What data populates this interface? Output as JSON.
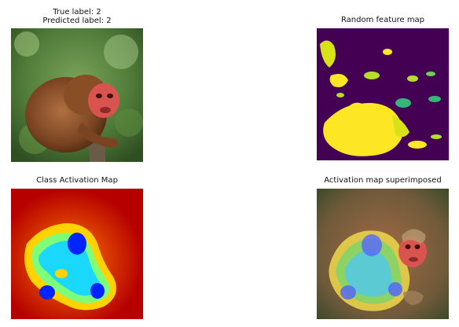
{
  "panels": {
    "top_left": {
      "title_line1": "True label: 2",
      "title_line2": "Predicted label: 2",
      "icon": "monkey-photo"
    },
    "top_right": {
      "title": "Random feature map",
      "icon": "feature-map-heatmap"
    },
    "bottom_left": {
      "title": "Class Activation Map",
      "icon": "class-activation-heatmap"
    },
    "bottom_right": {
      "title": "Activation map superimposed",
      "icon": "superimposed-activation-photo"
    }
  },
  "colors": {
    "background": "#ffffff",
    "viridis_purple": "#440154",
    "viridis_yellow": "#fde725",
    "jet_red": "#b60000",
    "jet_blue": "#0024ff"
  }
}
